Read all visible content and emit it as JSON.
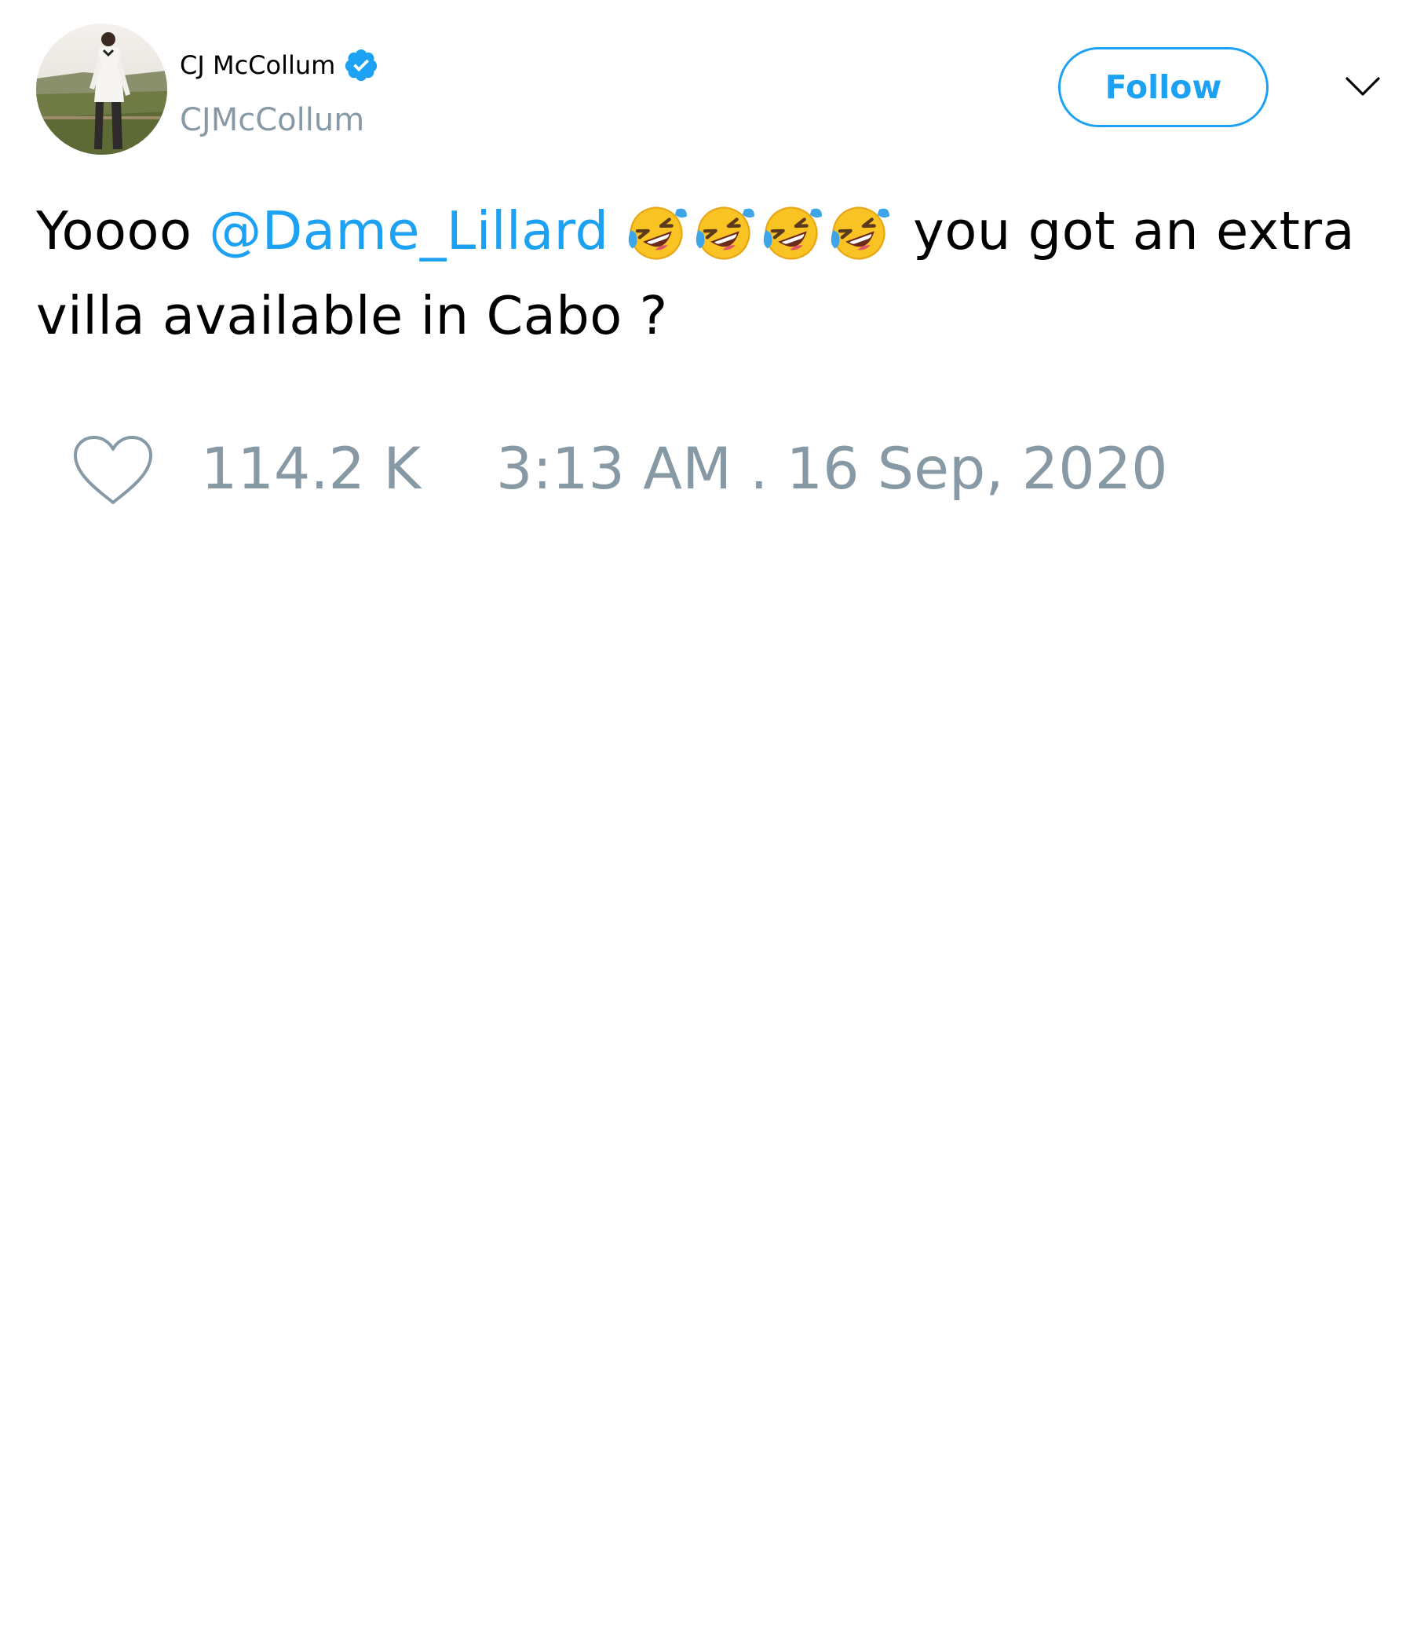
{
  "user": {
    "display_name": "CJ McCollum",
    "handle": "CJMcCollum",
    "verified": true
  },
  "follow_label": "Follow",
  "tweet": {
    "text_before_mention": "Yoooo ",
    "mention": "@Dame_Lillard",
    "emoji": [
      "rolling-on-floor-laughing-emoji",
      "rolling-on-floor-laughing-emoji",
      "rolling-on-floor-laughing-emoji",
      "rolling-on-floor-laughing-emoji"
    ],
    "text_after_emoji": " you got an extra villa available in Cabo ?"
  },
  "likes": "114.2 K",
  "timestamp": "3:13 AM . 16 Sep, 2020",
  "colors": {
    "accent": "#1da1f2",
    "muted": "#8899a6",
    "text": "#000000"
  },
  "icons": {
    "verified": "verified-badge-icon",
    "menu": "chevron-down-icon",
    "like": "heart-icon"
  }
}
